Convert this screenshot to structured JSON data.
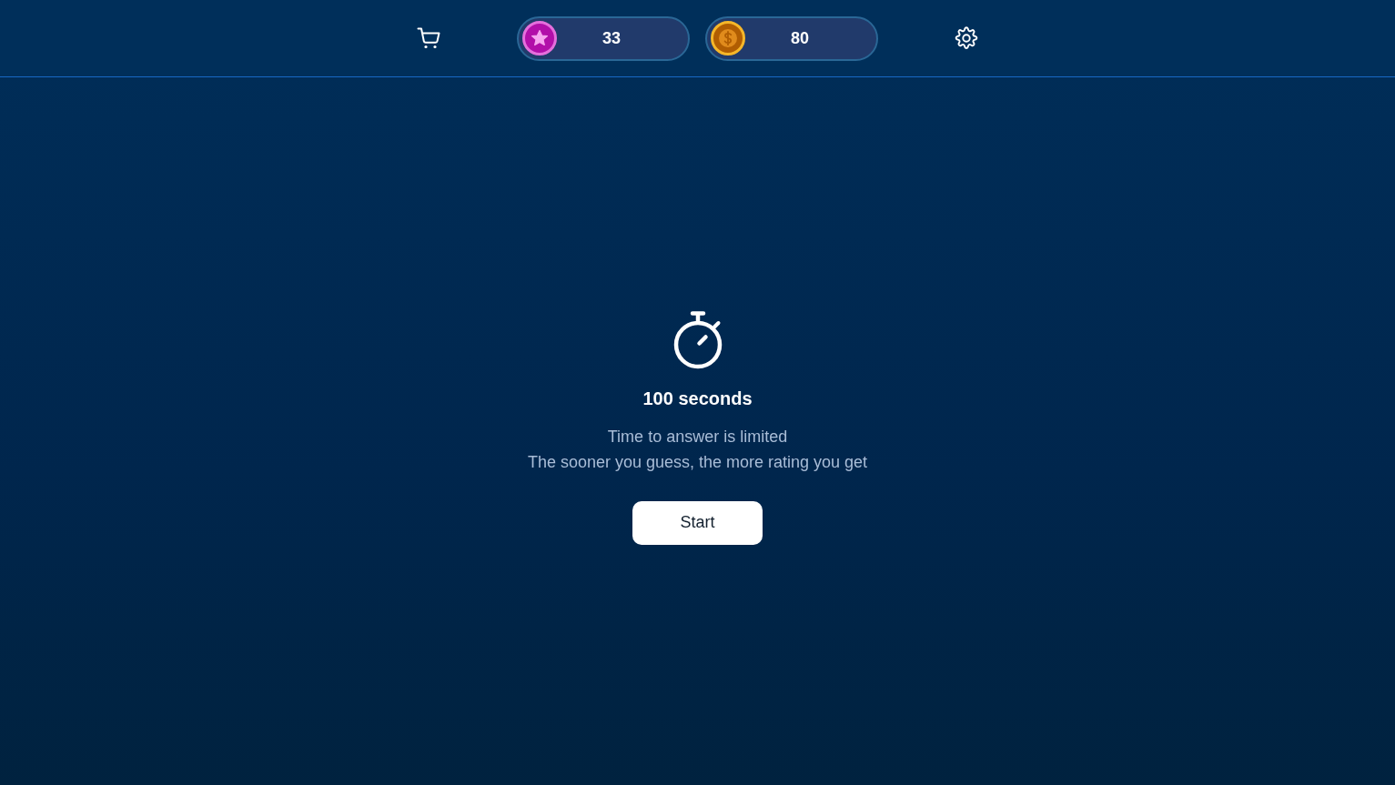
{
  "header": {
    "currencies": [
      {
        "kind": "star",
        "amount": "33"
      },
      {
        "kind": "coin",
        "amount": "80"
      }
    ]
  },
  "intro": {
    "duration": "100 seconds",
    "lines": [
      "Time to answer is limited",
      "The sooner you guess, the more rating you get"
    ],
    "start_button": {
      "label": "Start"
    }
  }
}
